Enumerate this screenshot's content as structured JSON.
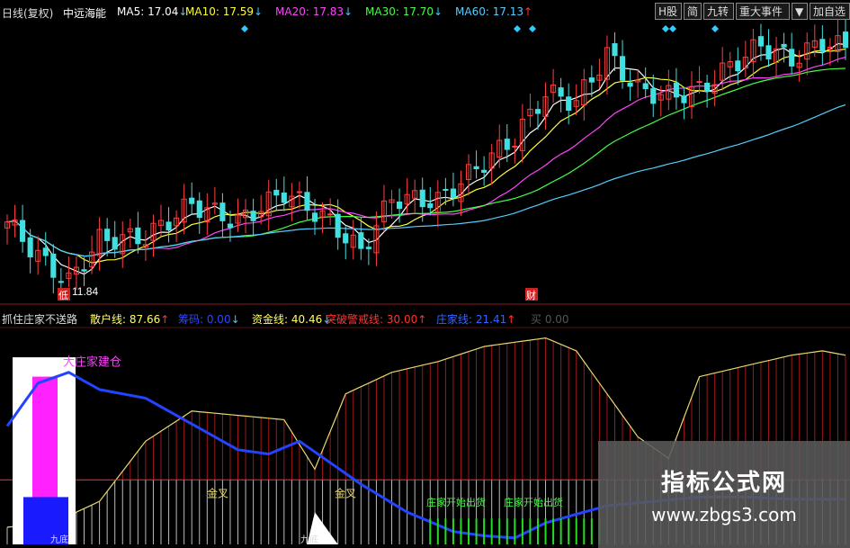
{
  "header": {
    "title": "日线(复权)",
    "stock": "中远海能",
    "ma": [
      {
        "label": "MA5:",
        "value": "17.04",
        "arrow": "↓",
        "color": "#ffffff"
      },
      {
        "label": "MA10:",
        "value": "17.59",
        "arrow": "↓",
        "color": "#ffff33"
      },
      {
        "label": "MA20:",
        "value": "17.83",
        "arrow": "↓",
        "color": "#ff44ff"
      },
      {
        "label": "MA30:",
        "value": "17.70",
        "arrow": "↓",
        "color": "#44ff44"
      },
      {
        "label": "MA60:",
        "value": "17.13",
        "arrow": "↑",
        "color": "#55ccff"
      }
    ],
    "buttons": [
      "H股",
      "简",
      "九转",
      "重大事件",
      "▼",
      "加自选"
    ]
  },
  "indicator": {
    "name": "抓住庄家不送路",
    "items": [
      {
        "label": "散户线:",
        "value": "87.66",
        "arrow": "↑",
        "color": "#ffff66",
        "arrow_color": "#ff3333"
      },
      {
        "label": "筹码:",
        "value": "0.00",
        "arrow": "↓",
        "color": "#3344ff",
        "arrow_color": "#33ccff"
      },
      {
        "label": "资金线:",
        "value": "40.46",
        "arrow": "↓",
        "color": "#ffff66",
        "arrow_color": "#33ccff"
      },
      {
        "label": "突破警戒线:",
        "value": "30.00",
        "arrow": "↑",
        "color": "#ff3333",
        "arrow_color": "#ff3333"
      },
      {
        "label": "庄家线:",
        "value": "21.41",
        "arrow": "↑",
        "color": "#3366ff",
        "arrow_color": "#ff3333"
      },
      {
        "label": "买",
        "value": "0.00",
        "arrow": "",
        "color": "#555555",
        "arrow_color": "#555555"
      }
    ]
  },
  "annotations": {
    "low_price": "11.84",
    "low_tag": "低",
    "fin_tag": "财",
    "big_build": "大庄家建仓",
    "golden_cross": [
      "金叉",
      "金叉"
    ],
    "pull_up": [
      "庄家开始出货",
      "庄家开始出货"
    ],
    "bottom_marks": [
      "九底",
      "九底"
    ]
  },
  "chart_data": [
    {
      "type": "candlestick",
      "title": "中远海能 日线(复权)",
      "series": [
        {
          "name": "MA5",
          "last": 17.04,
          "color": "#ffffff"
        },
        {
          "name": "MA10",
          "last": 17.59,
          "color": "#ffff33"
        },
        {
          "name": "MA20",
          "last": 17.83,
          "color": "#ff44ff"
        },
        {
          "name": "MA30",
          "last": 17.7,
          "color": "#44ff44"
        },
        {
          "name": "MA60",
          "last": 17.13,
          "color": "#55ccff"
        }
      ],
      "low_label": 11.84
    },
    {
      "type": "area",
      "title": "抓住庄家不送路",
      "ylim": [
        0,
        100
      ],
      "alert_line": 30,
      "series": [
        {
          "name": "散户线",
          "last": 87.66,
          "color": "#ffff66"
        },
        {
          "name": "资金线",
          "last": 40.46,
          "color": "#ffff66"
        },
        {
          "name": "庄家线",
          "last": 21.41,
          "color": "#3366ff"
        },
        {
          "name": "筹码",
          "last": 0.0,
          "color": "#3344ff"
        },
        {
          "name": "突破警戒线",
          "last": 30.0,
          "color": "#ff3333"
        }
      ]
    }
  ],
  "watermark": {
    "line1": "指标公式网",
    "line2": "www.zbgs3.com"
  }
}
